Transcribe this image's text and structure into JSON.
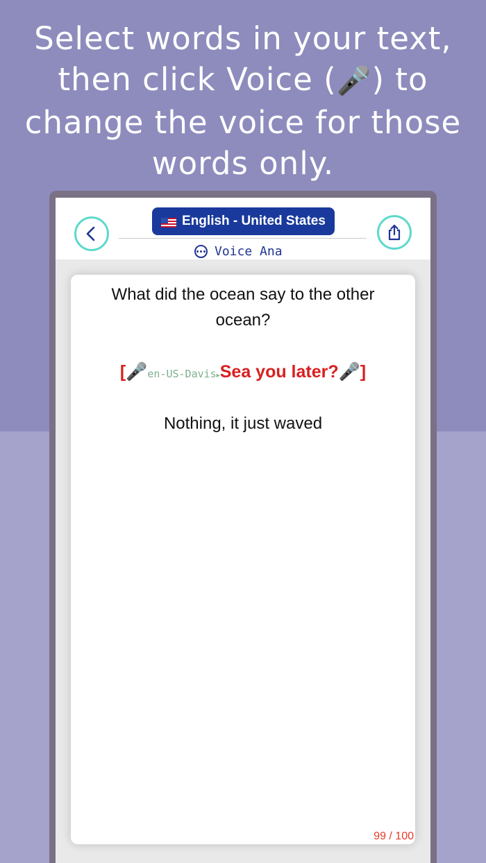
{
  "headline": {
    "line1": "Select words in your text,",
    "line2_start": "then click Voice (",
    "mic_glyph": "🎤",
    "line2_end": ") to",
    "line3": "change the voice for those",
    "line4": "words only."
  },
  "navbar": {
    "back_icon": "chevron-left-icon",
    "share_icon": "share-icon",
    "language_label": "English - United States",
    "voice_label": "Voice Ana",
    "accent_color": "#5ed9cc",
    "pill_color": "#193a9c"
  },
  "card": {
    "question": "What did the ocean say to the other ocean?",
    "tagged_segment": {
      "open_bracket": "[",
      "mic_glyph": "🎤",
      "voice_name": "en-US-Davis",
      "arrow": "▸",
      "text": "Sea you later?",
      "close_mic_glyph": "🎤",
      "close_bracket": "]"
    },
    "answer": "Nothing, it just waved",
    "counter": "99 / 100"
  }
}
